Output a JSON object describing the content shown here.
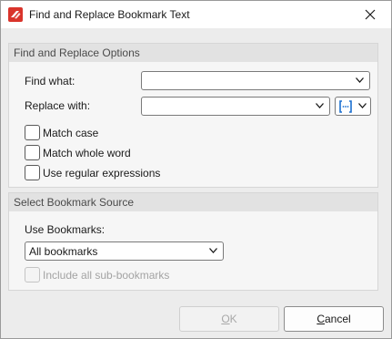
{
  "window": {
    "title": "Find and Replace Bookmark Text"
  },
  "options": {
    "header": "Find and Replace Options",
    "find_label": "Find what:",
    "find_value": "",
    "replace_label": "Replace with:",
    "replace_value": "",
    "tag_icon": "bracket-placeholder-icon",
    "checkboxes": [
      {
        "label": "Match case",
        "checked": false
      },
      {
        "label": "Match whole word",
        "checked": false
      },
      {
        "label": "Use regular expressions",
        "checked": false
      }
    ]
  },
  "source": {
    "header": "Select Bookmark Source",
    "use_label": "Use Bookmarks:",
    "use_value": "All bookmarks",
    "include_sub_label": "Include all sub-bookmarks",
    "include_sub_checked": false,
    "include_sub_enabled": false
  },
  "buttons": {
    "ok": {
      "mnemonic": "O",
      "rest": "K",
      "enabled": false
    },
    "cancel": {
      "mnemonic": "C",
      "rest": "ancel",
      "enabled": true
    }
  },
  "colors": {
    "accent": "#1a6fd0",
    "app_icon": "#d9342b"
  }
}
